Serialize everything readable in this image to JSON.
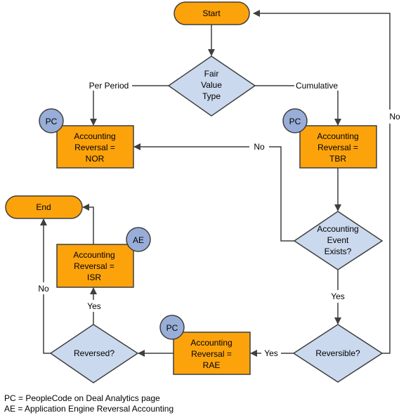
{
  "colors": {
    "process_fill": "#fca30c",
    "decision_fill": "#cbd9ee",
    "badge_fill": "#98aed8",
    "stroke": "#3f3f3f"
  },
  "nodes": {
    "start": {
      "label": "Start"
    },
    "end": {
      "label": "End"
    },
    "fair_value_type": {
      "lines": [
        "Fair",
        "Value",
        "Type"
      ]
    },
    "nor": {
      "lines": [
        "Accounting",
        "Reversal =",
        "NOR"
      ],
      "badge": "PC"
    },
    "tbr": {
      "lines": [
        "Accounting",
        "Reversal =",
        "TBR"
      ],
      "badge": "PC"
    },
    "accounting_event_exists": {
      "lines": [
        "Accounting",
        "Event",
        "Exists?"
      ]
    },
    "reversible": {
      "label": "Reversible?"
    },
    "rae": {
      "lines": [
        "Accounting",
        "Reversal =",
        "RAE"
      ],
      "badge": "PC"
    },
    "reversed": {
      "label": "Reversed?"
    },
    "isr": {
      "lines": [
        "Accounting",
        "Reversal =",
        "ISR"
      ],
      "badge": "AE"
    }
  },
  "edges": {
    "per_period": "Per Period",
    "cumulative": "Cumulative",
    "aee_no": "No",
    "aee_yes": "Yes",
    "reversible_no": "No",
    "reversible_yes": "Yes",
    "reversed_yes": "Yes",
    "reversed_no": "No"
  },
  "legend": [
    "PC = PeopleCode on Deal Analytics page",
    "AE = Application Engine Reversal Accounting"
  ]
}
